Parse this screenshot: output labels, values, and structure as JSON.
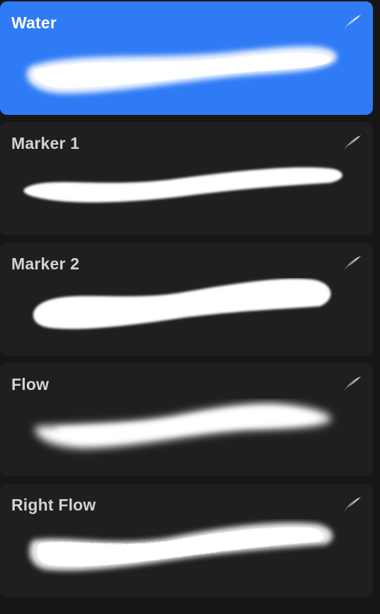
{
  "brushes": [
    {
      "label": "Water",
      "selected": true,
      "icon": "feather-icon"
    },
    {
      "label": "Marker 1",
      "selected": false,
      "icon": "feather-icon"
    },
    {
      "label": "Marker 2",
      "selected": false,
      "icon": "feather-icon"
    },
    {
      "label": "Flow",
      "selected": false,
      "icon": "feather-icon"
    },
    {
      "label": "Right Flow",
      "selected": false,
      "icon": "feather-icon"
    }
  ],
  "colors": {
    "selected_bg": "#2f7bf5",
    "card_bg": "#1f1f1f",
    "page_bg": "#161616",
    "label": "#d3d3d3",
    "stroke": "#ffffff"
  }
}
